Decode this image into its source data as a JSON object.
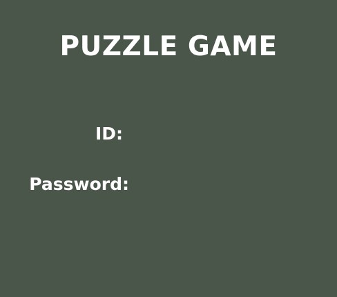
{
  "app": {
    "title": "PUZZLE GAME"
  },
  "login": {
    "id_label": "ID:",
    "id_value": "",
    "password_label": "Password:",
    "password_value": ""
  },
  "colors": {
    "background": "#4a5649",
    "text": "#ffffff"
  }
}
